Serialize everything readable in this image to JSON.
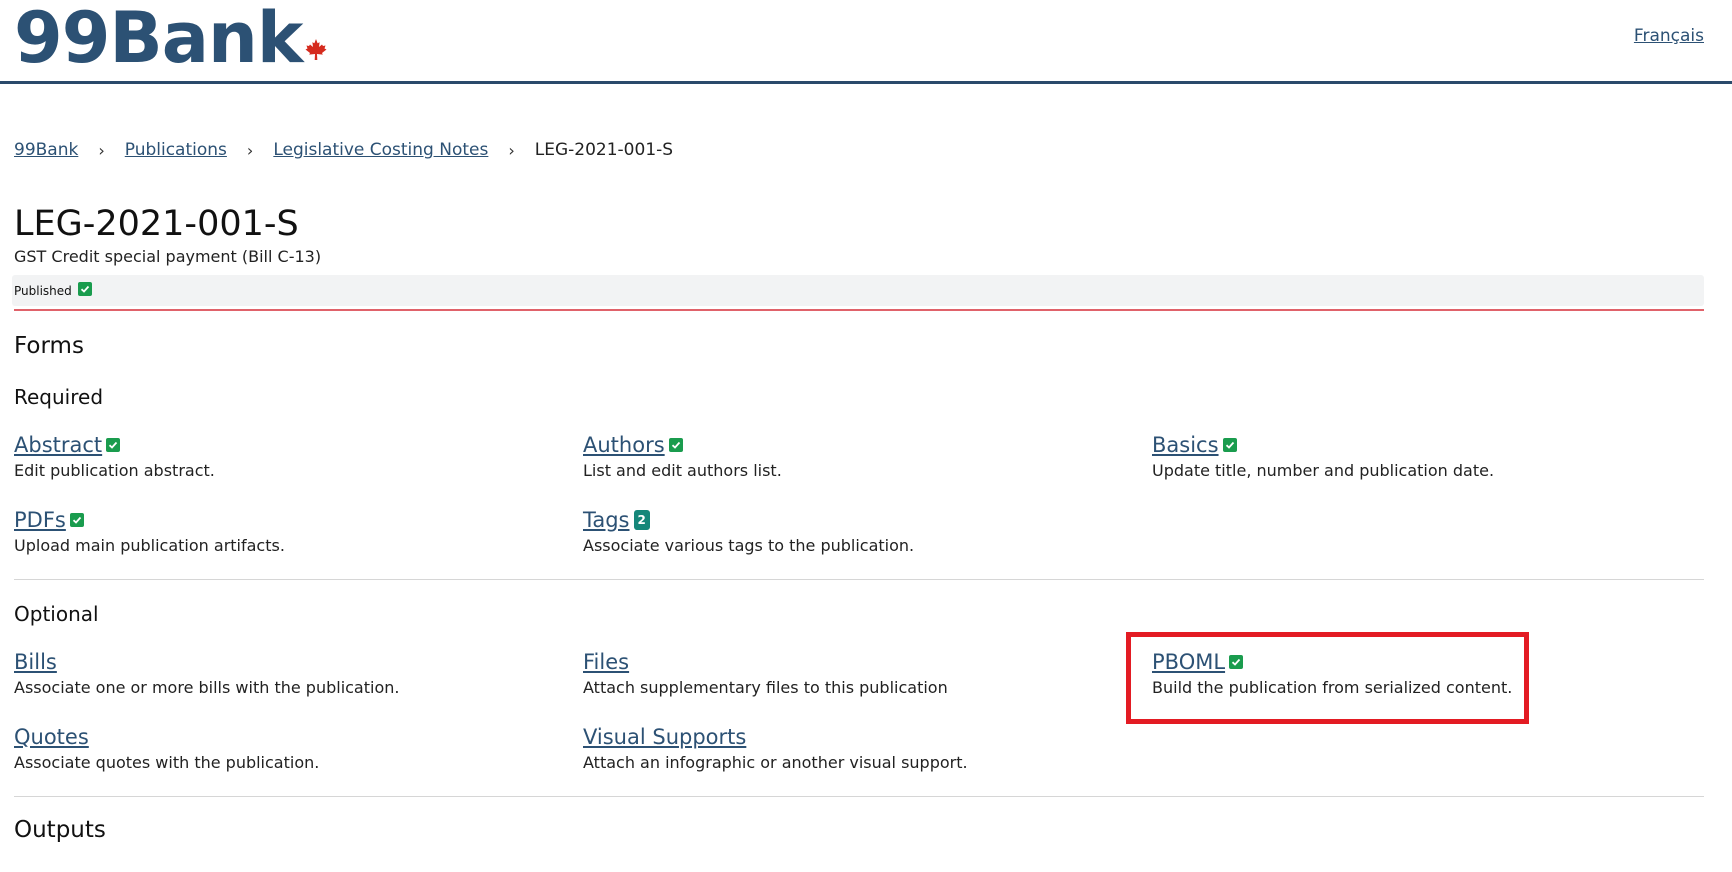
{
  "header": {
    "logo_text": "99Bank",
    "language_link": "Français"
  },
  "breadcrumb": {
    "items": [
      "99Bank",
      "Publications",
      "Legislative Costing Notes"
    ],
    "current": "LEG-2021-001-S",
    "separator": "›"
  },
  "publication": {
    "title": "LEG-2021-001-S",
    "subtitle": "GST Credit special payment (Bill C-13)",
    "status": "Published"
  },
  "forms": {
    "heading": "Forms",
    "required": {
      "heading": "Required",
      "items": [
        {
          "label": "Abstract",
          "description": "Edit publication abstract.",
          "badge": "check"
        },
        {
          "label": "Authors",
          "description": "List and edit authors list.",
          "badge": "check"
        },
        {
          "label": "Basics",
          "description": "Update title, number and publication date.",
          "badge": "check"
        },
        {
          "label": "PDFs",
          "description": "Upload main publication artifacts.",
          "badge": "check"
        },
        {
          "label": "Tags",
          "description": "Associate various tags to the publication.",
          "badge_count": "2"
        }
      ]
    },
    "optional": {
      "heading": "Optional",
      "items": [
        {
          "label": "Bills",
          "description": "Associate one or more bills with the publication."
        },
        {
          "label": "Files",
          "description": "Attach supplementary files to this publication"
        },
        {
          "label": "PBOML",
          "description": "Build the publication from serialized content.",
          "badge": "check"
        },
        {
          "label": "Quotes",
          "description": "Associate quotes with the publication."
        },
        {
          "label": "Visual Supports",
          "description": "Attach an infographic or another visual support."
        }
      ]
    }
  },
  "outputs": {
    "heading": "Outputs"
  },
  "colors": {
    "brand": "#2c5174",
    "success": "#1a9c4e",
    "info": "#15877a",
    "highlight": "#e31b23",
    "status_rule": "#e0626a"
  },
  "icons": {
    "logo_mark": "maple-leaf-icon",
    "status": "check-icon"
  }
}
